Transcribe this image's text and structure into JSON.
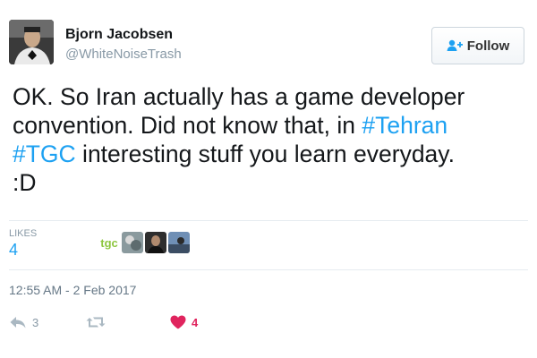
{
  "user": {
    "name": "Bjorn Jacobsen",
    "handle": "@WhiteNoiseTrash"
  },
  "follow_button": {
    "label": "Follow",
    "icon": "add-user-icon"
  },
  "tweet": {
    "segments": [
      {
        "text": "OK. So Iran actually has a game developer",
        "tag": false
      },
      {
        "text": "convention. Did not know that, in ",
        "tag": false
      },
      {
        "text": "#Tehran",
        "tag": true
      },
      {
        "text": "#TGC",
        "tag": true
      },
      {
        "text": " interesting stuff you learn everyday.",
        "tag": false
      },
      {
        "text": ":D",
        "tag": false
      }
    ]
  },
  "stats": {
    "likes_label": "LIKES",
    "likes_count": "4",
    "likers": [
      "tgc-logo",
      "user-avatar-2",
      "user-avatar-3",
      "user-avatar-4"
    ]
  },
  "timestamp": "12:55 AM - 2 Feb 2017",
  "actions": {
    "reply_count": "3",
    "retweet_count": "",
    "like_count": "4"
  },
  "colors": {
    "link": "#1da1f2",
    "like_active": "#e0245e",
    "muted": "#8899a6"
  }
}
